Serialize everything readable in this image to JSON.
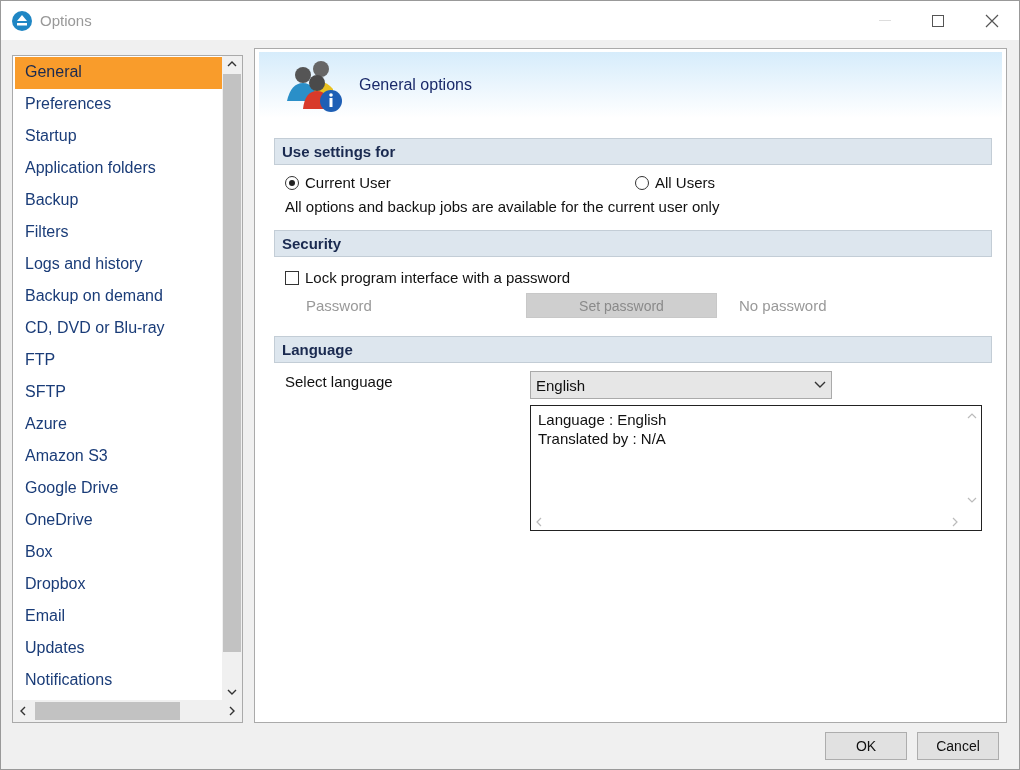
{
  "window": {
    "title": "Options"
  },
  "sidebar": {
    "items": [
      {
        "label": "General",
        "selected": true
      },
      {
        "label": "Preferences",
        "selected": false
      },
      {
        "label": "Startup",
        "selected": false
      },
      {
        "label": "Application folders",
        "selected": false
      },
      {
        "label": "Backup",
        "selected": false
      },
      {
        "label": "Filters",
        "selected": false
      },
      {
        "label": "Logs and history",
        "selected": false
      },
      {
        "label": "Backup on demand",
        "selected": false
      },
      {
        "label": "CD, DVD or Blu-ray",
        "selected": false
      },
      {
        "label": "FTP",
        "selected": false
      },
      {
        "label": "SFTP",
        "selected": false
      },
      {
        "label": "Azure",
        "selected": false
      },
      {
        "label": "Amazon S3",
        "selected": false
      },
      {
        "label": "Google Drive",
        "selected": false
      },
      {
        "label": "OneDrive",
        "selected": false
      },
      {
        "label": "Box",
        "selected": false
      },
      {
        "label": "Dropbox",
        "selected": false
      },
      {
        "label": "Email",
        "selected": false
      },
      {
        "label": "Updates",
        "selected": false
      },
      {
        "label": "Notifications",
        "selected": false
      }
    ]
  },
  "header": {
    "title": "General options"
  },
  "use_settings": {
    "title": "Use settings for",
    "options": [
      {
        "label": "Current User",
        "selected": true
      },
      {
        "label": "All Users",
        "selected": false
      }
    ],
    "note": "All options and backup jobs are available for the current user only"
  },
  "security": {
    "title": "Security",
    "lock": {
      "label": "Lock program interface with a password",
      "checked": false
    },
    "password_label": "Password",
    "set_password": {
      "label": "Set password",
      "disabled": true
    },
    "status": "No password"
  },
  "language": {
    "title": "Language",
    "label": "Select language",
    "value": "English",
    "info": [
      "Language : English",
      "Translated by : N/A"
    ]
  },
  "buttons": [
    {
      "label": "OK"
    },
    {
      "label": "Cancel"
    }
  ]
}
